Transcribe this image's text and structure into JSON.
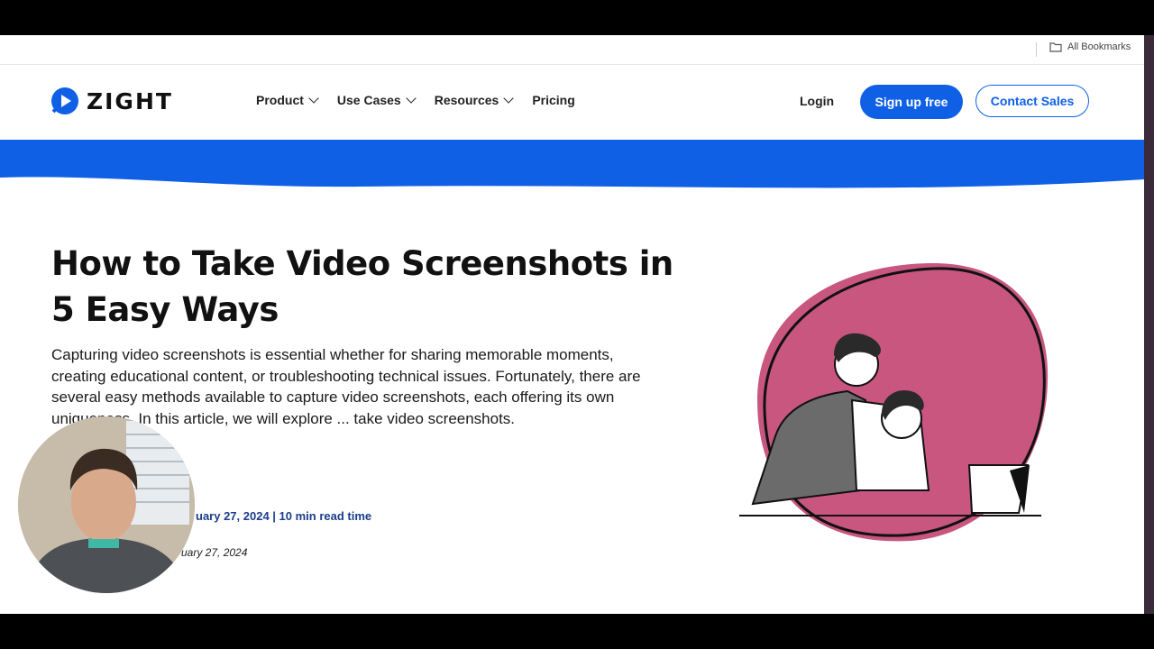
{
  "bookmarks": {
    "all_label": "All Bookmarks",
    "icon": "folder-icon"
  },
  "brand": {
    "name": "ZIGHT",
    "color": "#1060e6"
  },
  "nav": {
    "items": [
      {
        "label": "Product",
        "dropdown": true
      },
      {
        "label": "Use Cases",
        "dropdown": true
      },
      {
        "label": "Resources",
        "dropdown": true
      },
      {
        "label": "Pricing",
        "dropdown": false
      }
    ],
    "login": "Login",
    "signup": "Sign up free",
    "contact": "Contact Sales"
  },
  "article": {
    "title": "How to Take Video Screenshots in 5 Easy Ways",
    "intro": "Capturing video screenshots is essential whether for sharing memorable moments, creating educational content, or troubleshooting technical issues. Fortunately, there are several easy methods available to capture video screenshots, each offering its own uniqueness. In this article, we will explore ... take video screenshots.",
    "published": "uary 27, 2024 | 10 min read time",
    "updated": "uary 27, 2024"
  },
  "colors": {
    "accent": "#1060e6",
    "illustration_blob": "#c8567f"
  }
}
